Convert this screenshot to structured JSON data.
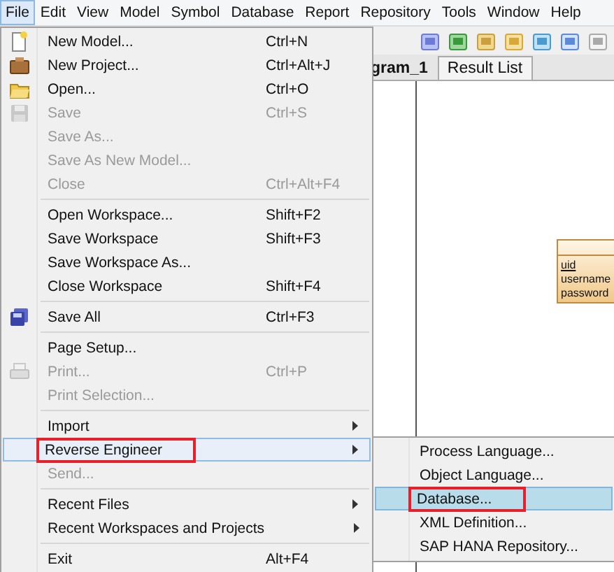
{
  "menubar": [
    {
      "label": "File",
      "selected": true
    },
    {
      "label": "Edit",
      "selected": false
    },
    {
      "label": "View",
      "selected": false
    },
    {
      "label": "Model",
      "selected": false
    },
    {
      "label": "Symbol",
      "selected": false
    },
    {
      "label": "Database",
      "selected": false
    },
    {
      "label": "Report",
      "selected": false
    },
    {
      "label": "Repository",
      "selected": false
    },
    {
      "label": "Tools",
      "selected": false
    },
    {
      "label": "Window",
      "selected": false
    },
    {
      "label": "Help",
      "selected": false
    }
  ],
  "tabs": [
    {
      "label": "gram_1",
      "selected": false
    },
    {
      "label": "Result List",
      "selected": true
    }
  ],
  "entity": {
    "attributes": [
      {
        "name": "uid",
        "primary": true
      },
      {
        "name": "username",
        "primary": false
      },
      {
        "name": "password",
        "primary": false
      }
    ]
  },
  "file_menu": [
    {
      "kind": "item",
      "label": "New Model...",
      "shortcut": "Ctrl+N",
      "disabled": false,
      "submenu": false,
      "selected": false,
      "annotated": false
    },
    {
      "kind": "item",
      "label": "New Project...",
      "shortcut": "Ctrl+Alt+J",
      "disabled": false,
      "submenu": false,
      "selected": false,
      "annotated": false
    },
    {
      "kind": "item",
      "label": "Open...",
      "shortcut": "Ctrl+O",
      "disabled": false,
      "submenu": false,
      "selected": false,
      "annotated": false
    },
    {
      "kind": "item",
      "label": "Save",
      "shortcut": "Ctrl+S",
      "disabled": true,
      "submenu": false,
      "selected": false,
      "annotated": false
    },
    {
      "kind": "item",
      "label": "Save As...",
      "disabled": true,
      "submenu": false,
      "selected": false,
      "annotated": false
    },
    {
      "kind": "item",
      "label": "Save As New Model...",
      "disabled": true,
      "submenu": false,
      "selected": false,
      "annotated": false
    },
    {
      "kind": "item",
      "label": "Close",
      "shortcut": "Ctrl+Alt+F4",
      "disabled": true,
      "submenu": false,
      "selected": false,
      "annotated": false
    },
    {
      "kind": "separator"
    },
    {
      "kind": "item",
      "label": "Open Workspace...",
      "shortcut": "Shift+F2",
      "disabled": false,
      "submenu": false,
      "selected": false,
      "annotated": false
    },
    {
      "kind": "item",
      "label": "Save Workspace",
      "shortcut": "Shift+F3",
      "disabled": false,
      "submenu": false,
      "selected": false,
      "annotated": false
    },
    {
      "kind": "item",
      "label": "Save Workspace As...",
      "disabled": false,
      "submenu": false,
      "selected": false,
      "annotated": false
    },
    {
      "kind": "item",
      "label": "Close Workspace",
      "shortcut": "Shift+F4",
      "disabled": false,
      "submenu": false,
      "selected": false,
      "annotated": false
    },
    {
      "kind": "separator"
    },
    {
      "kind": "item",
      "label": "Save All",
      "shortcut": "Ctrl+F3",
      "disabled": false,
      "submenu": false,
      "selected": false,
      "annotated": false
    },
    {
      "kind": "separator"
    },
    {
      "kind": "item",
      "label": "Page Setup...",
      "disabled": false,
      "submenu": false,
      "selected": false,
      "annotated": false
    },
    {
      "kind": "item",
      "label": "Print...",
      "shortcut": "Ctrl+P",
      "disabled": true,
      "submenu": false,
      "selected": false,
      "annotated": false
    },
    {
      "kind": "item",
      "label": "Print Selection...",
      "disabled": true,
      "submenu": false,
      "selected": false,
      "annotated": false
    },
    {
      "kind": "separator"
    },
    {
      "kind": "item",
      "label": "Import",
      "disabled": false,
      "submenu": true,
      "selected": false,
      "annotated": false
    },
    {
      "kind": "item",
      "label": "Reverse Engineer",
      "disabled": false,
      "submenu": true,
      "selected": true,
      "annotated": true
    },
    {
      "kind": "item",
      "label": "Send...",
      "disabled": true,
      "submenu": false,
      "selected": false,
      "annotated": false
    },
    {
      "kind": "separator"
    },
    {
      "kind": "item",
      "label": "Recent Files",
      "disabled": false,
      "submenu": true,
      "selected": false,
      "annotated": false
    },
    {
      "kind": "item",
      "label": "Recent Workspaces and Projects",
      "disabled": false,
      "submenu": true,
      "selected": false,
      "annotated": false
    },
    {
      "kind": "separator"
    },
    {
      "kind": "item",
      "label": "Exit",
      "shortcut": "Alt+F4",
      "disabled": false,
      "submenu": false,
      "selected": false,
      "annotated": false
    }
  ],
  "reverse_engineer_menu": [
    {
      "label": "Process Language...",
      "selected": false,
      "annotated": false
    },
    {
      "label": "Object Language...",
      "selected": false,
      "annotated": false
    },
    {
      "label": "Database...",
      "selected": true,
      "annotated": true
    },
    {
      "label": "XML Definition...",
      "selected": false,
      "annotated": false
    },
    {
      "label": "SAP HANA Repository...",
      "selected": false,
      "annotated": false
    }
  ]
}
